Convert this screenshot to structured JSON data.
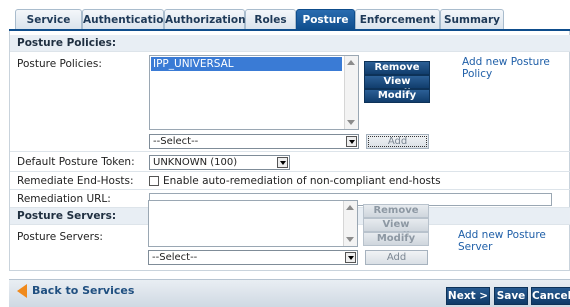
{
  "tabs": [
    {
      "label": "Service",
      "active": false
    },
    {
      "label": "Authentication",
      "active": false
    },
    {
      "label": "Authorization",
      "active": false
    },
    {
      "label": "Roles",
      "active": false
    },
    {
      "label": "Posture",
      "active": true
    },
    {
      "label": "Enforcement",
      "active": false
    },
    {
      "label": "Summary",
      "active": false
    }
  ],
  "policies_section": {
    "heading": "Posture Policies:",
    "label": "Posture Policies:",
    "selected_item": "IPP_UNIVERSAL",
    "remove": "Remove",
    "view_details": "View Details",
    "modify": "Modify",
    "select_value": "--Select--",
    "add": "Add",
    "add_new": "Add new Posture Policy"
  },
  "token": {
    "label": "Default Posture Token:",
    "value": "UNKNOWN (100)"
  },
  "remediate": {
    "label": "Remediate End-Hosts:",
    "checkbox_label": "Enable auto-remediation of non-compliant end-hosts",
    "checked": false
  },
  "remediation_url": {
    "label": "Remediation URL:",
    "value": ""
  },
  "servers_section": {
    "heading": "Posture Servers:",
    "label": "Posture Servers:",
    "remove": "Remove",
    "view_details": "View Details",
    "modify": "Modify",
    "select_value": "--Select--",
    "add": "Add",
    "add_new": "Add new Posture Server"
  },
  "footer": {
    "back": "Back to Services",
    "next": "Next >",
    "save": "Save",
    "cancel": "Cancel"
  },
  "colors": {
    "accent": "#0e4d8c",
    "selection": "#3a7bd5",
    "back_arrow": "#f08a1c"
  }
}
